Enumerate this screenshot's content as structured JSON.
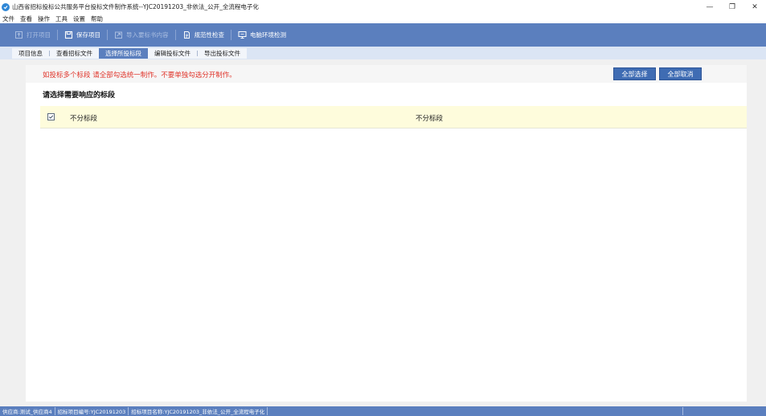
{
  "window": {
    "title": "山西省招标投标公共服务平台投标文件制作系统--YJC20191203_非依法_公开_全流程电子化",
    "minimize": "—",
    "restore": "❐",
    "close": "✕"
  },
  "menu": [
    "文件",
    "查看",
    "操作",
    "工具",
    "设置",
    "帮助"
  ],
  "toolbar": {
    "open": "打开项目",
    "save": "保存项目",
    "import": "导入要标书内容",
    "check": "规范性检查",
    "env": "电脑环境检测"
  },
  "tabs": [
    "项目信息",
    "查看招标文件",
    "选择所投标段",
    "编辑投标文件",
    "导出投标文件"
  ],
  "active_tab_index": 2,
  "notice": {
    "text": "如投标多个标段 请全部勾选统一制作。不要单独勾选分开制作。",
    "select_all": "全部选择",
    "cancel_all": "全部取消"
  },
  "section_title": "请选择需要响应的标段",
  "bid_rows": [
    {
      "checked": true,
      "name": "不分标段",
      "name2": "不分标段"
    }
  ],
  "status": {
    "supplier": "供应商:测试_供应商4",
    "project_no": "招标项目编号:YJC20191203",
    "project_name": "招标项目名称:YJC20191203_非依法_公开_全流程电子化"
  },
  "colors": {
    "toolbar": "#5b7fbe",
    "notice_text": "#e0352b",
    "button": "#3f6cb3",
    "row_highlight": "#fefcdc"
  }
}
